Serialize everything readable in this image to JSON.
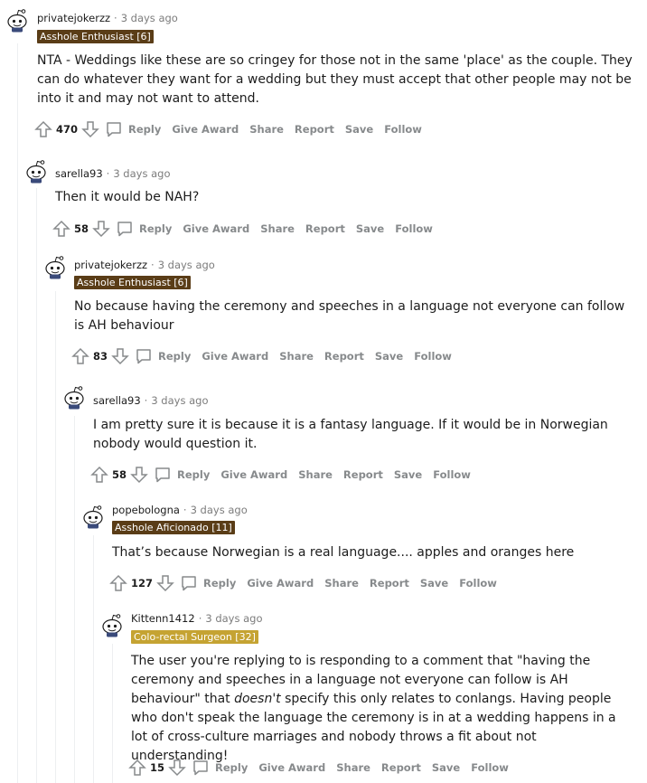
{
  "colors": {
    "flair_dark": "#5a3d17",
    "flair_gold": "#c5a332",
    "meta": "#7c7c7c",
    "action": "#878a8c",
    "thread": "#edeff1"
  },
  "actions": {
    "reply": "Reply",
    "give_award": "Give Award",
    "share": "Share",
    "report": "Report",
    "save": "Save",
    "follow": "Follow"
  },
  "comments": [
    {
      "username": "privatejokerzz",
      "time": "3 days ago",
      "flair": "Asshole Enthusiast [6]",
      "body": "NTA - Weddings like these are so cringey for those not in the same 'place' as the couple. They can do whatever they want for a wedding but they must accept that other people may not be into it and may not want to attend.",
      "score": "470",
      "avatar": "snoo-avatar-icon"
    },
    {
      "username": "sarella93",
      "time": "3 days ago",
      "flair": "",
      "body": "Then it would be NAH?",
      "score": "58",
      "avatar": "snoo-avatar-icon"
    },
    {
      "username": "privatejokerzz",
      "time": "3 days ago",
      "flair": "Asshole Enthusiast [6]",
      "body": "No because having the ceremony and speeches in a language not everyone can follow is AH behaviour",
      "score": "83",
      "avatar": "snoo-avatar-icon"
    },
    {
      "username": "sarella93",
      "time": "3 days ago",
      "flair": "",
      "body": "I am pretty sure it is because it is a fantasy language. If it would be in Norwegian nobody would question it.",
      "score": "58",
      "avatar": "snoo-avatar-icon"
    },
    {
      "username": "popebologna",
      "time": "3 days ago",
      "flair": "Asshole Aficionado [11]",
      "body": "That’s because Norwegian is a real language.... apples and oranges here",
      "score": "127",
      "avatar": "snoo-avatar-icon"
    },
    {
      "username": "Kittenn1412",
      "time": "3 days ago",
      "flair": "Colo-rectal Surgeon [32]",
      "body_pre": "The user you're replying to is responding to a comment that \"having the ceremony and speeches in a language not everyone can follow is AH behaviour\" that ",
      "body_em": "doesn't",
      "body_post": " specify this only relates to conlangs. Having people who don't speak the language the ceremony is in at a wedding happens in a lot of cross-culture marriages and nobody throws a fit about not understanding!",
      "score": "15",
      "avatar": "snoo-avatar-icon"
    }
  ]
}
